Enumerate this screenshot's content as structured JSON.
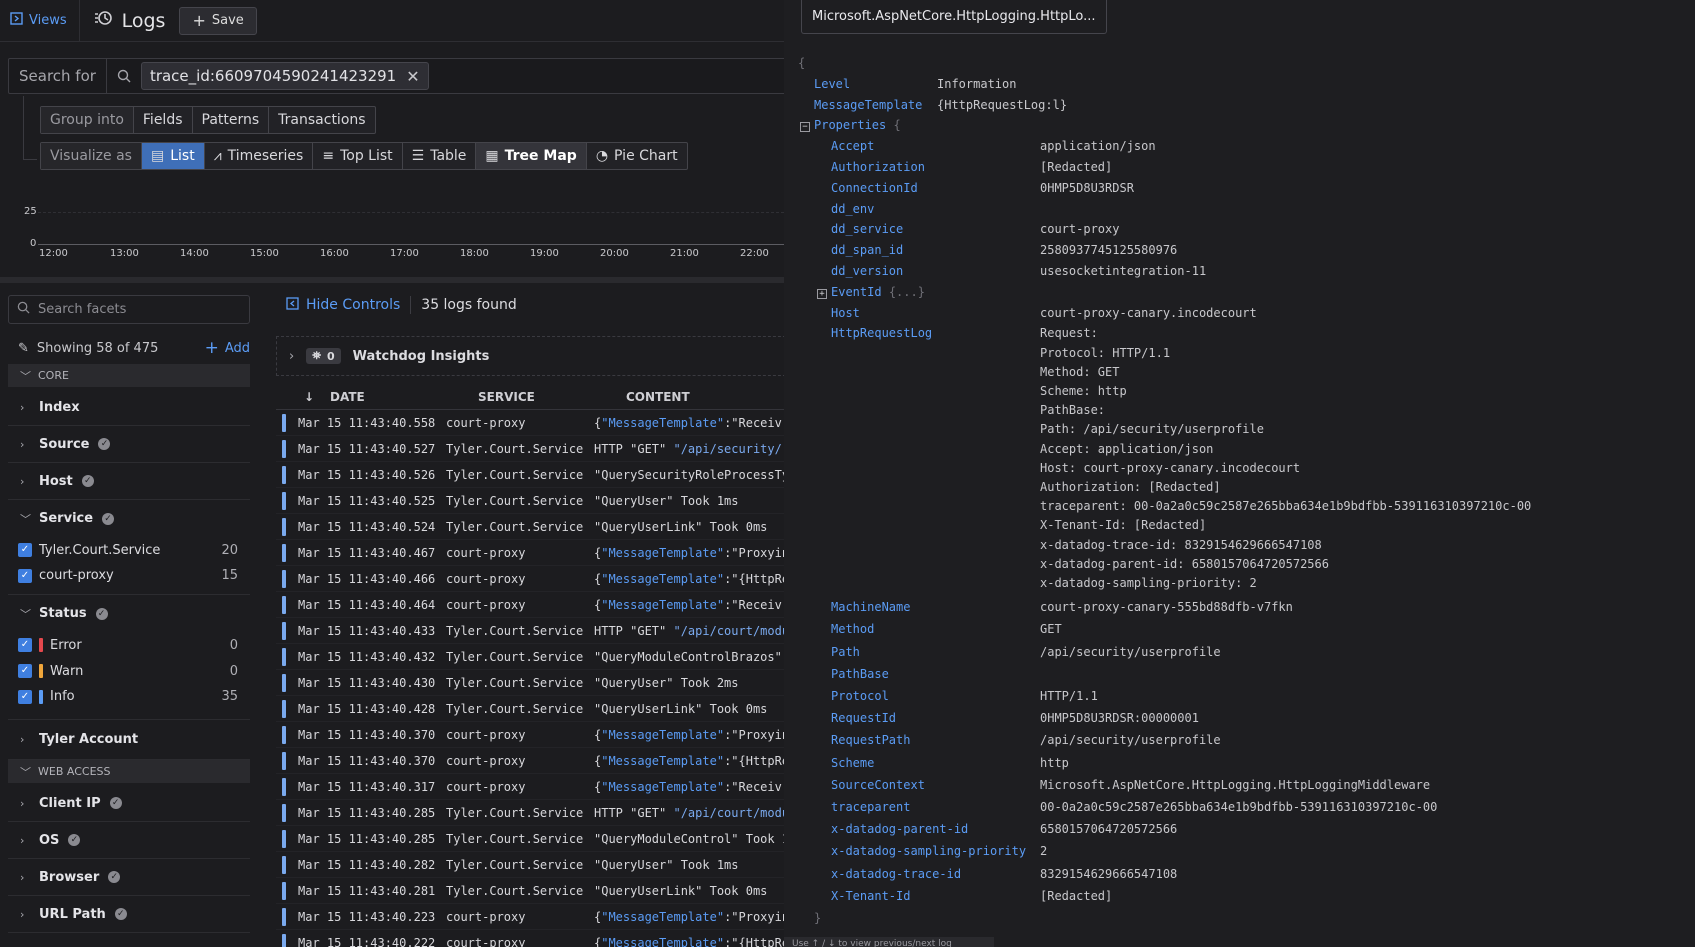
{
  "header": {
    "views_label": "Views",
    "page_title": "Logs",
    "save_label": "Save"
  },
  "search": {
    "label": "Search for",
    "query_chip": "trace_id:6609704590241423291"
  },
  "group": {
    "label": "Group into",
    "options": [
      "Fields",
      "Patterns",
      "Transactions"
    ]
  },
  "visualize": {
    "label": "Visualize as",
    "options": [
      "List",
      "Timeseries",
      "Top List",
      "Table",
      "Tree Map",
      "Pie Chart"
    ],
    "active": "List"
  },
  "timeline": {
    "y_ticks": [
      "25",
      "0"
    ],
    "x_ticks": [
      "12:00",
      "13:00",
      "14:00",
      "15:00",
      "16:00",
      "17:00",
      "18:00",
      "19:00",
      "20:00",
      "21:00",
      "22:00"
    ]
  },
  "facets": {
    "search_placeholder": "Search facets",
    "showing": "Showing 58 of 475",
    "add_label": "Add",
    "core_label": "CORE",
    "index": "Index",
    "source": "Source",
    "host": "Host",
    "service": {
      "label": "Service",
      "items": [
        {
          "name": "Tyler.Court.Service",
          "count": "20"
        },
        {
          "name": "court-proxy",
          "count": "15"
        }
      ]
    },
    "status": {
      "label": "Status",
      "items": [
        {
          "name": "Error",
          "count": "0",
          "color": "#e5484d"
        },
        {
          "name": "Warn",
          "count": "0",
          "color": "#f0a63b"
        },
        {
          "name": "Info",
          "count": "35",
          "color": "#5b9cf5"
        }
      ]
    },
    "tyler_account": "Tyler Account",
    "web_access_label": "WEB ACCESS",
    "client_ip": "Client IP",
    "os": "OS",
    "browser": "Browser",
    "url_path": "URL Path"
  },
  "list": {
    "hide_controls": "Hide Controls",
    "count": "35 logs found",
    "insights_count": "0",
    "insights_label": "Watchdog Insights",
    "columns": [
      "DATE",
      "SERVICE",
      "CONTENT"
    ],
    "rows": [
      {
        "date": "Mar 15 11:43:40.558",
        "service": "court-proxy",
        "content": "{\"MessageTemplate\":\"Receiv"
      },
      {
        "date": "Mar 15 11:43:40.527",
        "service": "Tyler.Court.Service",
        "content": "HTTP \"GET\" \"/api/security/"
      },
      {
        "date": "Mar 15 11:43:40.526",
        "service": "Tyler.Court.Service",
        "content": "\"QuerySecurityRoleProcessTy"
      },
      {
        "date": "Mar 15 11:43:40.525",
        "service": "Tyler.Court.Service",
        "content": "\"QueryUser\" Took 1ms"
      },
      {
        "date": "Mar 15 11:43:40.524",
        "service": "Tyler.Court.Service",
        "content": "\"QueryUserLink\" Took 0ms"
      },
      {
        "date": "Mar 15 11:43:40.467",
        "service": "court-proxy",
        "content": "{\"MessageTemplate\":\"Proxyin"
      },
      {
        "date": "Mar 15 11:43:40.466",
        "service": "court-proxy",
        "content": "{\"MessageTemplate\":\"{HttpRe"
      },
      {
        "date": "Mar 15 11:43:40.464",
        "service": "court-proxy",
        "content": "{\"MessageTemplate\":\"Receiv"
      },
      {
        "date": "Mar 15 11:43:40.433",
        "service": "Tyler.Court.Service",
        "content": "HTTP \"GET\" \"/api/court/modu"
      },
      {
        "date": "Mar 15 11:43:40.432",
        "service": "Tyler.Court.Service",
        "content": "\"QueryModuleControlBrazos\""
      },
      {
        "date": "Mar 15 11:43:40.430",
        "service": "Tyler.Court.Service",
        "content": "\"QueryUser\" Took 2ms"
      },
      {
        "date": "Mar 15 11:43:40.428",
        "service": "Tyler.Court.Service",
        "content": "\"QueryUserLink\" Took 0ms"
      },
      {
        "date": "Mar 15 11:43:40.370",
        "service": "court-proxy",
        "content": "{\"MessageTemplate\":\"Proxyin"
      },
      {
        "date": "Mar 15 11:43:40.370",
        "service": "court-proxy",
        "content": "{\"MessageTemplate\":\"{HttpRe"
      },
      {
        "date": "Mar 15 11:43:40.317",
        "service": "court-proxy",
        "content": "{\"MessageTemplate\":\"Receiv"
      },
      {
        "date": "Mar 15 11:43:40.285",
        "service": "Tyler.Court.Service",
        "content": "HTTP \"GET\" \"/api/court/modu"
      },
      {
        "date": "Mar 15 11:43:40.285",
        "service": "Tyler.Court.Service",
        "content": "\"QueryModuleControl\" Took 1"
      },
      {
        "date": "Mar 15 11:43:40.282",
        "service": "Tyler.Court.Service",
        "content": "\"QueryUser\" Took 1ms"
      },
      {
        "date": "Mar 15 11:43:40.281",
        "service": "Tyler.Court.Service",
        "content": "\"QueryUserLink\" Took 0ms"
      },
      {
        "date": "Mar 15 11:43:40.223",
        "service": "court-proxy",
        "content": "{\"MessageTemplate\":\"Proxyin"
      },
      {
        "date": "Mar 15 11:43:40.222",
        "service": "court-proxy",
        "content": "{\"MessageTemplate\":\"{HttpRe"
      }
    ]
  },
  "detail": {
    "tab_title": "Microsoft.AspNetCore.HttpLogging.HttpLo...",
    "open_brace": "{",
    "level_key": "Level",
    "level_value": "Information",
    "template_key": "MessageTemplate",
    "template_value": "{HttpRequestLog:l}",
    "properties_key": "Properties",
    "properties_brace": "{",
    "eventid_key": "EventId",
    "eventid_collapsed": "{...}",
    "attributes": [
      {
        "key": "Accept",
        "value": "application/json"
      },
      {
        "key": "Authorization",
        "value": "[Redacted]"
      },
      {
        "key": "ConnectionId",
        "value": "0HMP5D8U3RDSR"
      },
      {
        "key": "dd_env",
        "value": ""
      },
      {
        "key": "dd_service",
        "value": "court-proxy"
      },
      {
        "key": "dd_span_id",
        "value": "2580937745125580976"
      },
      {
        "key": "dd_version",
        "value": "usesocketintegration-11"
      }
    ],
    "host_key": "Host",
    "host_value": "court-proxy-canary.incodecourt",
    "httplog_key": "HttpRequestLog",
    "httplog_lines": [
      "Request:",
      "Protocol: HTTP/1.1",
      "Method: GET",
      "Scheme: http",
      "PathBase:",
      "Path: /api/security/userprofile",
      "Accept: application/json",
      "Host: court-proxy-canary.incodecourt",
      "Authorization: [Redacted]",
      "traceparent: 00-0a2a0c59c2587e265bba634e1b9bdfbb-539116310397210c-00",
      "X-Tenant-Id: [Redacted]",
      "x-datadog-trace-id: 8329154629666547108",
      "x-datadog-parent-id: 6580157064720572566",
      "x-datadog-sampling-priority: 2"
    ],
    "attributes2": [
      {
        "key": "MachineName",
        "value": "court-proxy-canary-555bd88dfb-v7fkn"
      },
      {
        "key": "Method",
        "value": "GET"
      },
      {
        "key": "Path",
        "value": "/api/security/userprofile"
      },
      {
        "key": "PathBase",
        "value": ""
      },
      {
        "key": "Protocol",
        "value": "HTTP/1.1"
      },
      {
        "key": "RequestId",
        "value": "0HMP5D8U3RDSR:00000001"
      },
      {
        "key": "RequestPath",
        "value": "/api/security/userprofile"
      },
      {
        "key": "Scheme",
        "value": "http"
      },
      {
        "key": "SourceContext",
        "value": "Microsoft.AspNetCore.HttpLogging.HttpLoggingMiddleware"
      },
      {
        "key": "traceparent",
        "value": "00-0a2a0c59c2587e265bba634e1b9bdfbb-539116310397210c-00"
      },
      {
        "key": "x-datadog-parent-id",
        "value": "6580157064720572566"
      },
      {
        "key": "x-datadog-sampling-priority",
        "value": "2"
      },
      {
        "key": "x-datadog-trace-id",
        "value": "8329154629666547108"
      },
      {
        "key": "X-Tenant-Id",
        "value": "[Redacted]"
      }
    ],
    "close_brace": "}",
    "footer_hint": "Use ↑ / ↓ to view previous/next log"
  }
}
